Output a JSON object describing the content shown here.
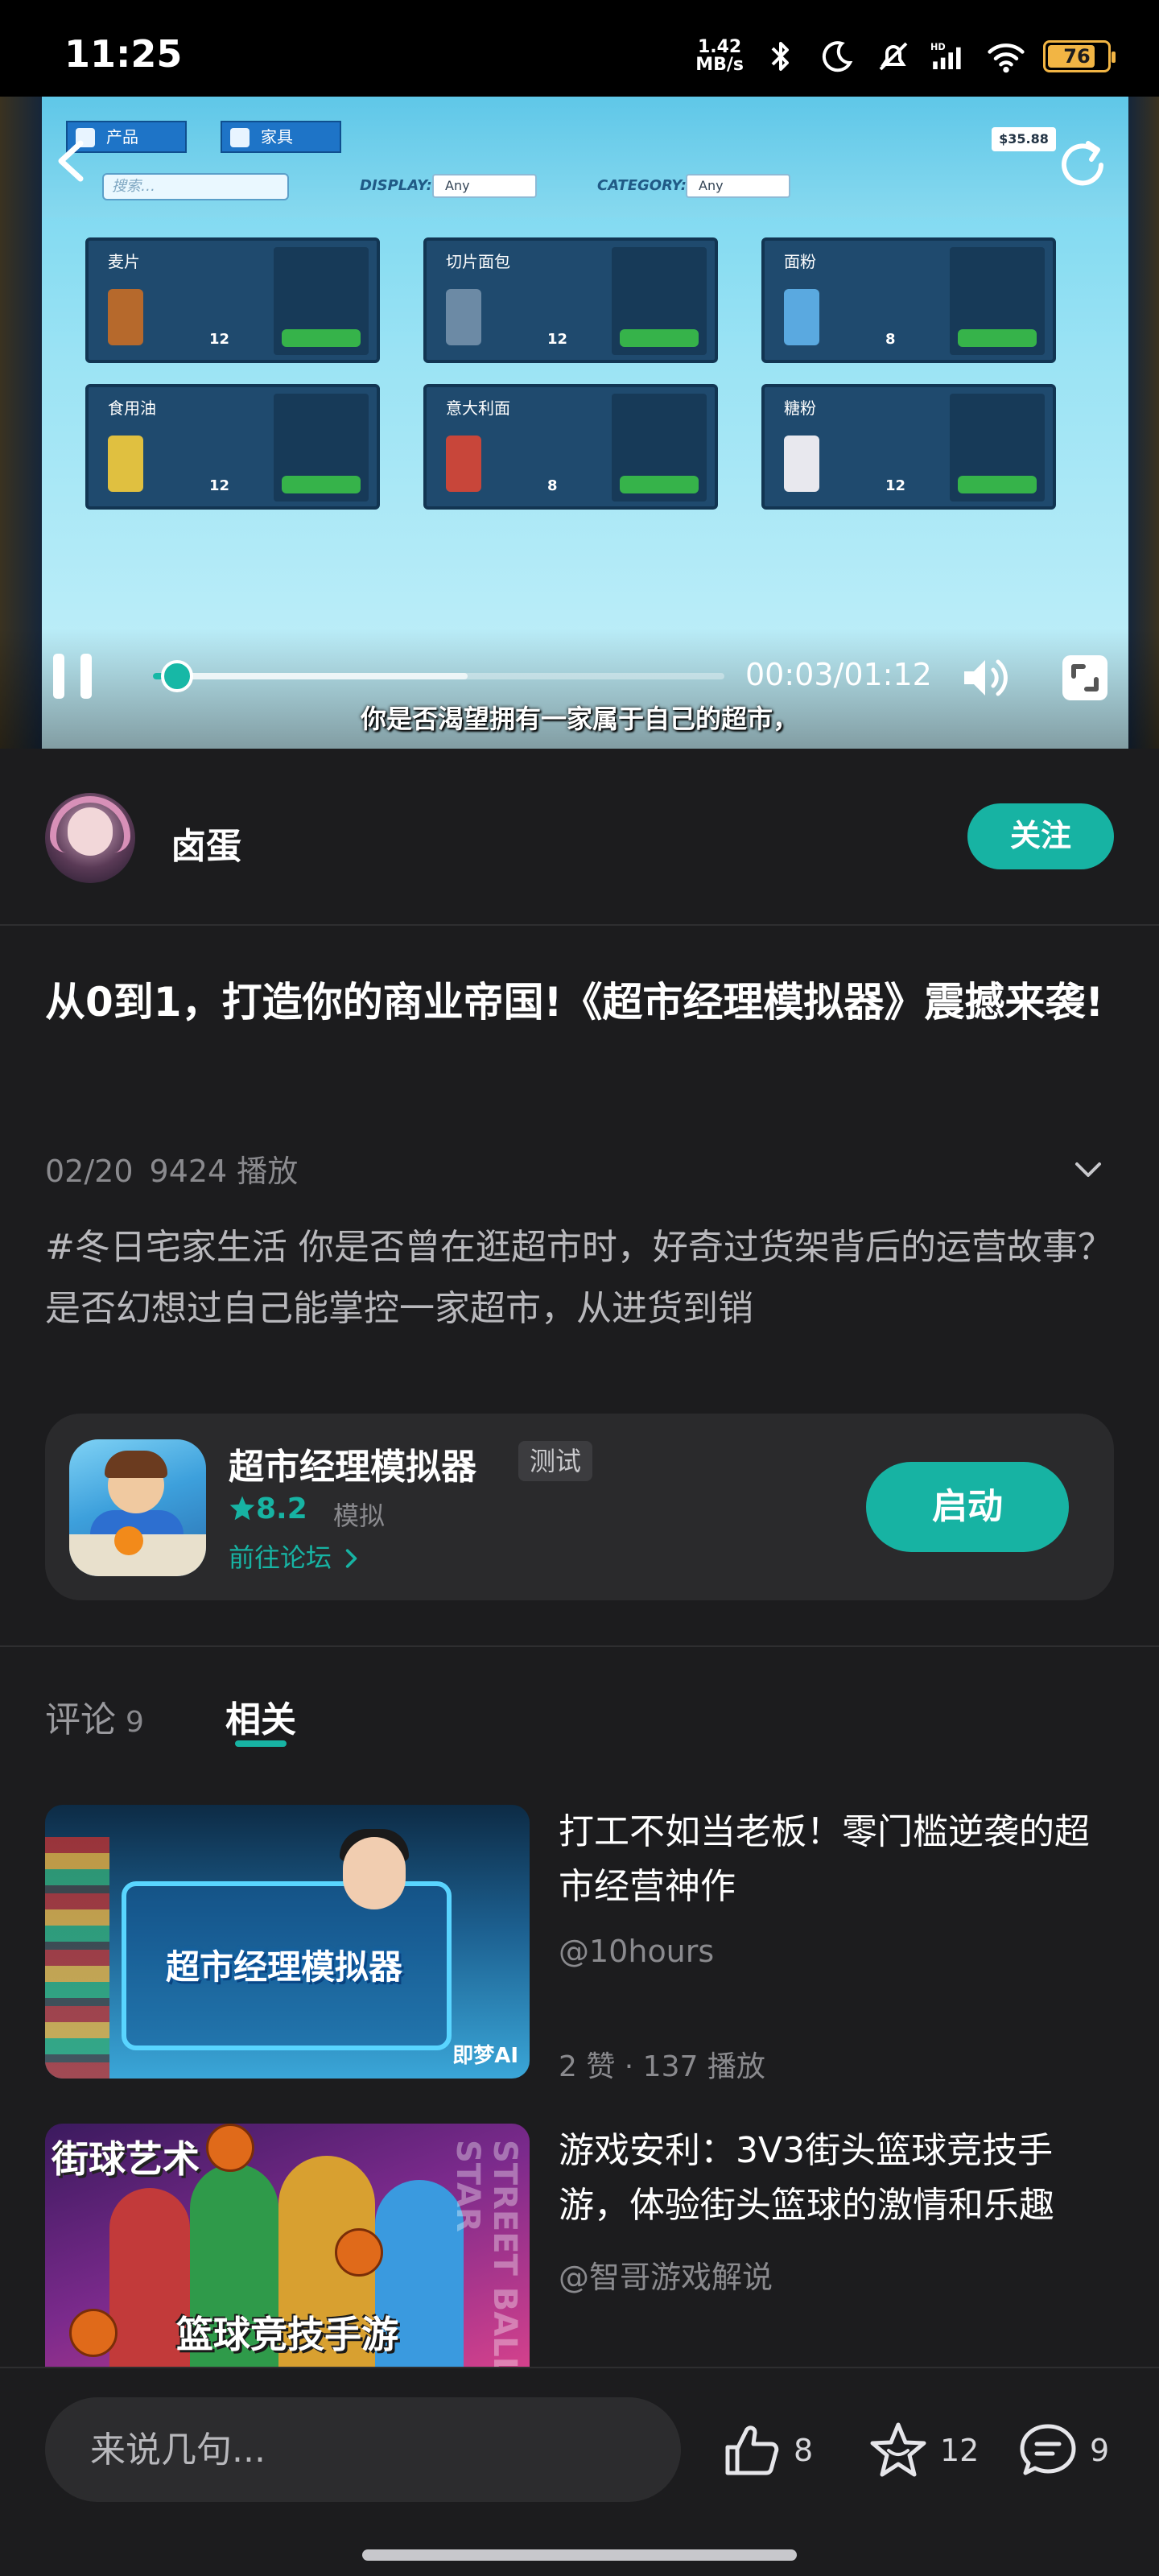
{
  "status_bar": {
    "time": "11:25",
    "net_speed": "1.42",
    "net_unit": "MB/s",
    "signal_tag": "HD",
    "battery": "76",
    "icons": [
      "bluetooth-icon",
      "moon-icon",
      "mute-bell-icon",
      "signal-icon",
      "wifi-icon",
      "battery-icon"
    ]
  },
  "video": {
    "game_ui": {
      "tab_products": "产品",
      "tab_furniture": "家具",
      "search_placeholder": "搜索…",
      "display_label": "DISPLAY:",
      "display_value": "Any",
      "category_label": "CATEGORY:",
      "category_value": "Any",
      "money": "$35.88",
      "cards": [
        {
          "name": "麦片",
          "price": "12"
        },
        {
          "name": "切片面包",
          "price": "12"
        },
        {
          "name": "面粉",
          "price": "8"
        },
        {
          "name": "食用油",
          "price": "12"
        },
        {
          "name": "意大利面",
          "price": "8"
        },
        {
          "name": "糖粉",
          "price": "12"
        }
      ]
    },
    "current_time": "00:03",
    "duration": "01:12",
    "time_display": "00:03/01:12",
    "progress": 0.042,
    "buffered": 0.55,
    "subtitle": "你是否渴望拥有一家属于自己的超市，"
  },
  "author": {
    "name": "卤蛋",
    "follow_label": "关注"
  },
  "post": {
    "title": "从0到1，打造你的商业帝国!《超市经理模拟器》震撼来袭!",
    "date": "02/20",
    "plays": "9424 播放",
    "description": "#冬日宅家生活 你是否曾在逛超市时，好奇过货架背后的运营故事？是否幻想过自己能掌控一家超市，从进货到销"
  },
  "game_card": {
    "name": "超市经理模拟器",
    "badge": "测试",
    "rating": "8.2",
    "category": "模拟",
    "forum_link": "前往论坛",
    "launch_label": "启动"
  },
  "tabs": {
    "comments_label": "评论",
    "comments_count": "9",
    "related_label": "相关"
  },
  "related": [
    {
      "title": "打工不如当老板！零门槛逆袭的超市经营神作",
      "author": "@10hours",
      "stats": "2 赞 · 137 播放",
      "thumb_text": "超市经理模拟器",
      "thumb_brand": "即梦AI"
    },
    {
      "title": "游戏安利：3V3街头篮球竞技手游，体验街头篮球的激情和乐趣",
      "author": "@智哥游戏解说",
      "stats": "",
      "thumb_text": "篮球竞技手游",
      "thumb_logo": "街球艺术",
      "thumb_side": "STREET BALL STAR"
    }
  ],
  "bottom_bar": {
    "comment_placeholder": "来说几句...",
    "likes": "8",
    "favorites": "12",
    "comments": "9"
  },
  "colors": {
    "accent": "#17b3a3",
    "background": "#1c1c1e",
    "card": "#2a2a2c",
    "muted_text": "#8a8a8e"
  }
}
